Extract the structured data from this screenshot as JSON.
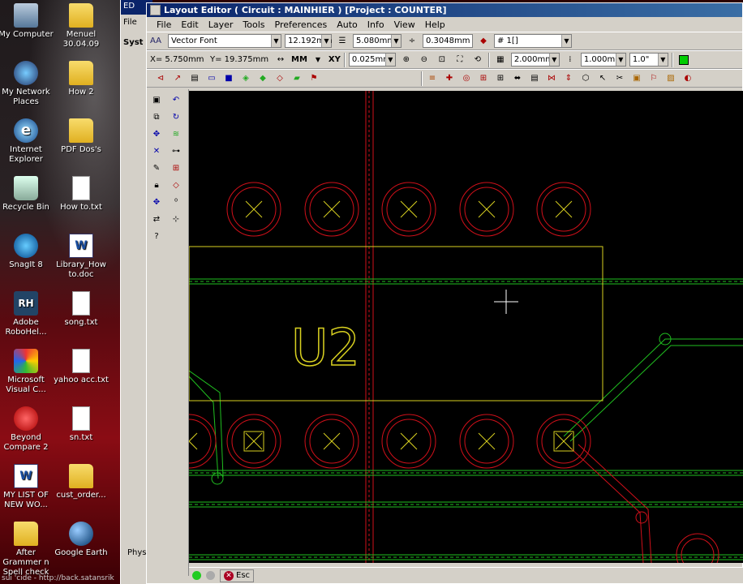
{
  "desktop": {
    "icons": [
      {
        "label": "My Computer"
      },
      {
        "label": "Menuel 30.04.09"
      },
      {
        "label": "My Network Places"
      },
      {
        "label": "How 2"
      },
      {
        "label": "Internet Explorer"
      },
      {
        "label": "PDF Dos's"
      },
      {
        "label": "Recycle Bin"
      },
      {
        "label": "How to.txt"
      },
      {
        "label": "SnagIt 8"
      },
      {
        "label": "Library_How to.doc"
      },
      {
        "label": "Adobe RoboHel..."
      },
      {
        "label": "song.txt"
      },
      {
        "label": "Microsoft Visual C..."
      },
      {
        "label": "yahoo acc.txt"
      },
      {
        "label": "Beyond Compare 2"
      },
      {
        "label": "sn.txt"
      },
      {
        "label": "MY LIST OF NEW WO..."
      },
      {
        "label": "cust_order..."
      },
      {
        "label": "After Grammer n Spell check"
      },
      {
        "label": "Google Earth"
      }
    ],
    "status_text": "sui 'cide - http://back.satansrik"
  },
  "bg_window": {
    "title": "ED",
    "menu": "File",
    "tree_label": "Syst",
    "tab": "Phys"
  },
  "app": {
    "title": "Layout Editor ( Circuit : MAINHIER ) [Project : COUNTER]",
    "menu": [
      "File",
      "Edit",
      "Layer",
      "Tools",
      "Preferences",
      "Auto",
      "Info",
      "View",
      "Help"
    ],
    "toolbar1": {
      "font_prefix": "AA",
      "font": "Vector Font",
      "text_height": "12.192mm",
      "line_width": "5.080mm",
      "spacing": "0.3048mm",
      "layer": "# 1[]"
    },
    "toolbar2": {
      "x_coord": "X= 5.750mm",
      "y_coord": "Y= 19.375mm",
      "units": "MM",
      "xy": "XY",
      "snap": "0.025mm",
      "grid": "2.000mm",
      "grid2": "1.000mm",
      "angle": "1.0\""
    },
    "canvas": {
      "component_label": "U2",
      "colors": {
        "pad": "#d0101a",
        "outline": "#d8d020",
        "trace": "#20c020",
        "background": "#000000"
      }
    },
    "status": {
      "esc_label": "Esc"
    }
  }
}
